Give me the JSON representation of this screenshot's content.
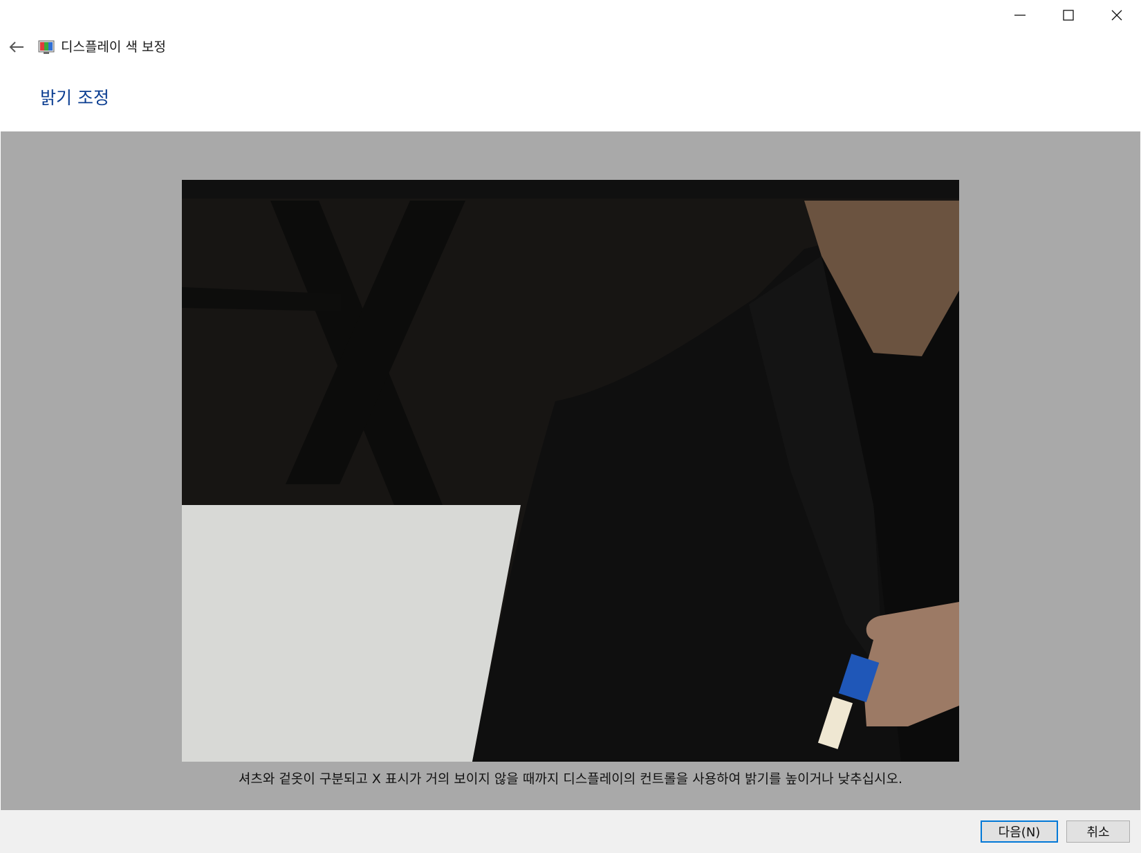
{
  "window": {
    "title": "디스플레이 색 보정",
    "controls": [
      "minimize-icon",
      "maximize-icon",
      "close-icon"
    ]
  },
  "header": {
    "back_icon": "back-arrow-icon",
    "app_icon": "display-color-calibration-icon",
    "heading": "밝기 조정"
  },
  "main": {
    "reference_image": "brightness-reference-photo",
    "instruction": "셔츠와 겉옷이 구분되고 X 표시가 거의 보이지 않을 때까지 디스플레이의 컨트롤을 사용하여 밝기를 높이거나 낮추십시오."
  },
  "footer": {
    "next_label": "다음(N)",
    "cancel_label": "취소"
  },
  "colors": {
    "heading": "#0a3d91",
    "content_bg": "#a9a9a9",
    "footer_bg": "#f0f0f0",
    "default_button_border": "#0078d7"
  }
}
